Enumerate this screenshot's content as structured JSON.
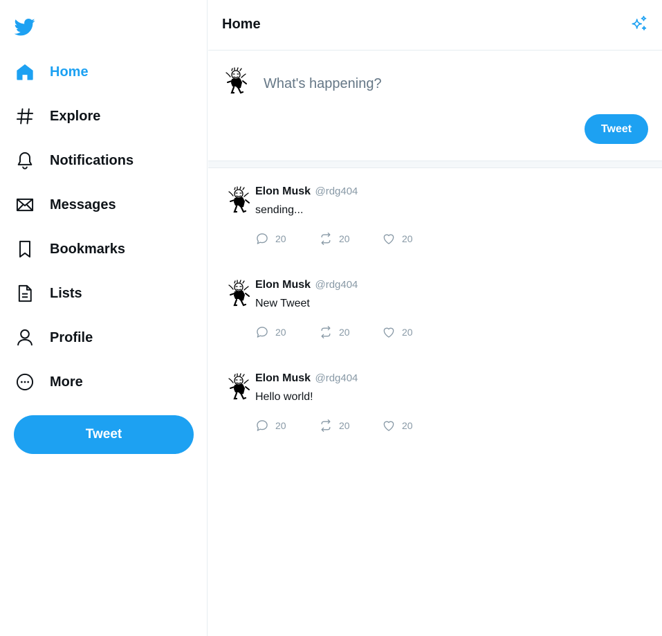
{
  "colors": {
    "accent": "#1da1f2",
    "text_primary": "#0f1419",
    "text_secondary": "#8899a6",
    "border": "#e6ecf0"
  },
  "sidebar": {
    "logo_icon": "twitter-bird-icon",
    "items": [
      {
        "label": "Home",
        "icon": "home-icon",
        "active": true
      },
      {
        "label": "Explore",
        "icon": "hashtag-icon"
      },
      {
        "label": "Notifications",
        "icon": "bell-icon"
      },
      {
        "label": "Messages",
        "icon": "envelope-icon"
      },
      {
        "label": "Bookmarks",
        "icon": "bookmark-icon"
      },
      {
        "label": "Lists",
        "icon": "list-document-icon"
      },
      {
        "label": "Profile",
        "icon": "user-icon"
      },
      {
        "label": "More",
        "icon": "more-circle-icon"
      }
    ],
    "tweet_button_label": "Tweet"
  },
  "header": {
    "title": "Home",
    "sparkle_icon": "sparkle-icon"
  },
  "composer": {
    "placeholder": "What's happening?",
    "value": "",
    "tweet_button_label": "Tweet"
  },
  "feed": [
    {
      "name": "Elon Musk",
      "handle": "@rdg404",
      "text": "sending...",
      "replies": "20",
      "retweets": "20",
      "likes": "20"
    },
    {
      "name": "Elon Musk",
      "handle": "@rdg404",
      "text": "New Tweet",
      "replies": "20",
      "retweets": "20",
      "likes": "20"
    },
    {
      "name": "Elon Musk",
      "handle": "@rdg404",
      "text": "Hello world!",
      "replies": "20",
      "retweets": "20",
      "likes": "20"
    }
  ]
}
